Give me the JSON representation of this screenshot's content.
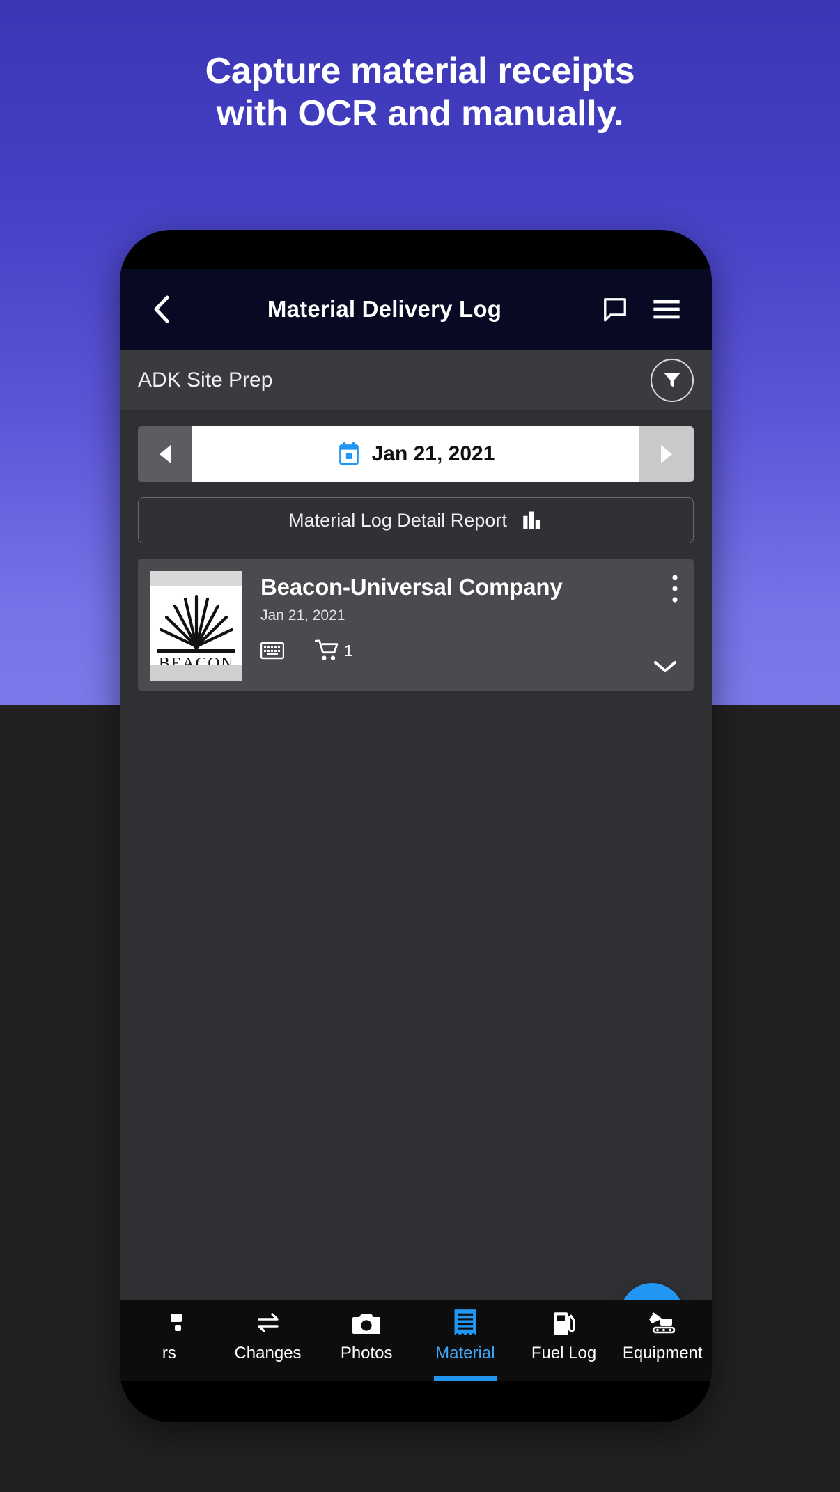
{
  "promo": {
    "headline_line1": "Capture material receipts",
    "headline_line2": "with OCR and manually.",
    "bg_top_color": "#3a36b4",
    "bg_mid_color": "#7b79ea",
    "bg_bottom_color": "#212121"
  },
  "appbar": {
    "title": "Material Delivery Log",
    "back_icon": "chevron-left-icon",
    "message_icon": "message-icon",
    "menu_icon": "hamburger-menu-icon",
    "background_color": "#080A23"
  },
  "project": {
    "name": "ADK Site Prep",
    "filter_icon": "filter-icon"
  },
  "date_bar": {
    "prev_icon": "triangle-left-icon",
    "next_icon": "triangle-right-icon",
    "calendar_icon": "calendar-icon",
    "value": "Jan 21, 2021",
    "calendar_accent": "#2196f3"
  },
  "report_button": {
    "label": "Material Log Detail Report",
    "icon": "bar-chart-icon"
  },
  "material_card": {
    "thumbnail_alt": "BEACON",
    "thumbnail_text": "BEACON",
    "title": "Beacon-Universal Company",
    "date": "Jan 21, 2021",
    "keyboard_icon": "keyboard-icon",
    "cart_icon": "shopping-cart-icon",
    "cart_count": "1",
    "kebab_icon": "more-vertical-icon",
    "expand_icon": "chevron-down-icon"
  },
  "fab": {
    "icon": "plus-icon",
    "color": "#2196f3"
  },
  "bottom_nav": {
    "active_color": "#42a5f5",
    "items": [
      {
        "label": "rs",
        "icon": "truncated-icon",
        "active": false
      },
      {
        "label": "Changes",
        "icon": "swap-arrows-icon",
        "active": false
      },
      {
        "label": "Photos",
        "icon": "camera-icon",
        "active": false
      },
      {
        "label": "Material",
        "icon": "receipt-icon",
        "active": true
      },
      {
        "label": "Fuel Log",
        "icon": "fuel-pump-icon",
        "active": false
      },
      {
        "label": "Equipment",
        "icon": "excavator-icon",
        "active": false
      }
    ]
  }
}
